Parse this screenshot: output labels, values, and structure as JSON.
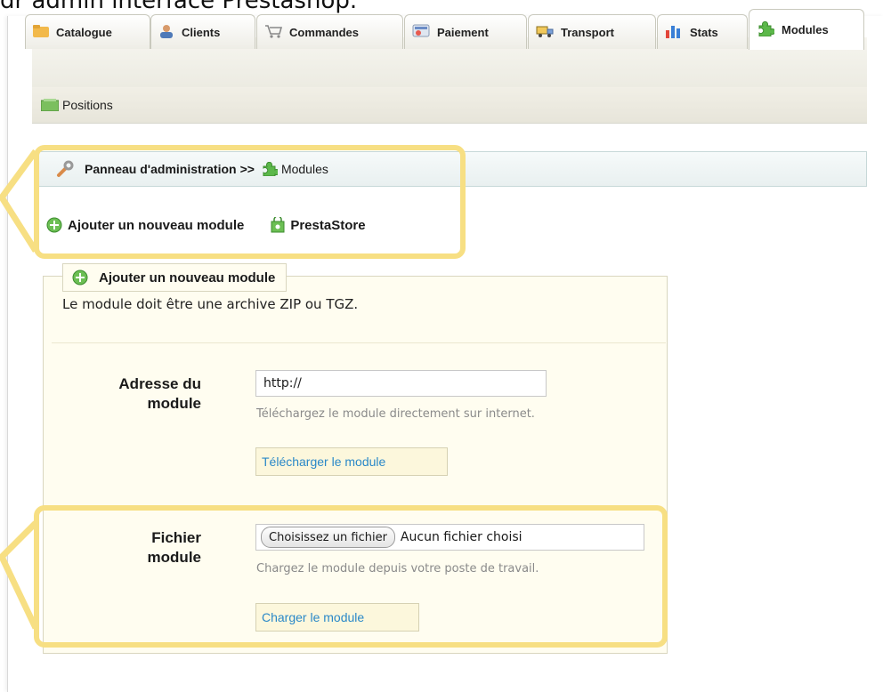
{
  "caption": "dr admin interface Prestashop.",
  "tabs": [
    {
      "label": "Catalogue",
      "icon": "folder-icon"
    },
    {
      "label": "Clients",
      "icon": "users-icon"
    },
    {
      "label": "Commandes",
      "icon": "cart-icon"
    },
    {
      "label": "Paiement",
      "icon": "payment-icon"
    },
    {
      "label": "Transport",
      "icon": "truck-icon"
    },
    {
      "label": "Stats",
      "icon": "bar-chart-icon"
    },
    {
      "label": "Modules",
      "icon": "puzzle-icon",
      "active": true
    }
  ],
  "subnav": {
    "positions_label": "Positions"
  },
  "breadcrumb": {
    "root": "Panneau d'administration",
    "separator": ">>",
    "current": "Modules"
  },
  "actions": {
    "add_module": "Ajouter un nouveau module",
    "prestastore": "PrestaStore"
  },
  "form": {
    "legend": "Ajouter un nouveau module",
    "intro": "Le module doit être une archive ZIP ou TGZ.",
    "url_label_1": "Adresse du",
    "url_label_2": "module",
    "url_value": "http://",
    "url_hint": "Téléchargez le module directement sur internet.",
    "download_button": "Télécharger le module",
    "file_label_1": "Fichier",
    "file_label_2": "module",
    "choose_button": "Choisissez un fichier",
    "no_file": "Aucun fichier choisi",
    "file_hint": "Chargez le module depuis votre poste de travail.",
    "upload_button": "Charger le module"
  },
  "colors": {
    "highlight": "#f7df83",
    "link": "#2a88c8",
    "fieldset_bg": "#fffdf0"
  }
}
